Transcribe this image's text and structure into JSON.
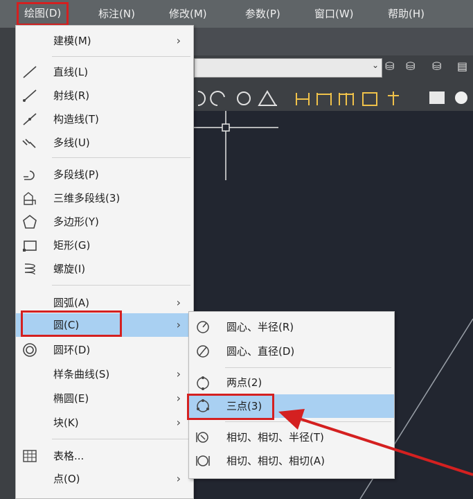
{
  "menubar": {
    "items": [
      "绘图(D)",
      "标注(N)",
      "修改(M)",
      "参数(P)",
      "窗口(W)",
      "帮助(H)"
    ]
  },
  "draw_menu": {
    "items": [
      {
        "label": "建模(M)",
        "icon": "",
        "submenu": true
      },
      {
        "label": "直线(L)",
        "icon": "line-icon"
      },
      {
        "label": "射线(R)",
        "icon": "ray-icon"
      },
      {
        "label": "构造线(T)",
        "icon": "construction-line-icon"
      },
      {
        "label": "多线(U)",
        "icon": "multiline-icon"
      },
      {
        "label": "多段线(P)",
        "icon": "polyline-icon"
      },
      {
        "label": "三维多段线(3)",
        "icon": "3d-polyline-icon"
      },
      {
        "label": "多边形(Y)",
        "icon": "polygon-icon"
      },
      {
        "label": "矩形(G)",
        "icon": "rectangle-icon"
      },
      {
        "label": "螺旋(I)",
        "icon": "helix-icon"
      },
      {
        "label": "圆弧(A)",
        "icon": "",
        "submenu": true
      },
      {
        "label": "圆(C)",
        "icon": "",
        "submenu": true,
        "active": true
      },
      {
        "label": "圆环(D)",
        "icon": "donut-icon"
      },
      {
        "label": "样条曲线(S)",
        "icon": "",
        "submenu": true
      },
      {
        "label": "椭圆(E)",
        "icon": "",
        "submenu": true
      },
      {
        "label": "块(K)",
        "icon": "",
        "submenu": true
      },
      {
        "label": "表格...",
        "icon": "table-icon"
      },
      {
        "label": "点(O)",
        "icon": "",
        "submenu": true
      }
    ]
  },
  "circle_submenu": {
    "items": [
      {
        "label": "圆心、半径(R)",
        "icon": "circle-center-radius-icon"
      },
      {
        "label": "圆心、直径(D)",
        "icon": "circle-center-diameter-icon"
      },
      {
        "label": "两点(2)",
        "icon": "circle-2point-icon"
      },
      {
        "label": "三点(3)",
        "icon": "circle-3point-icon",
        "active": true
      },
      {
        "label": "相切、相切、半径(T)",
        "icon": "circle-ttr-icon"
      },
      {
        "label": "相切、相切、相切(A)",
        "icon": "circle-ttt-icon"
      }
    ]
  },
  "colors": {
    "highlight": "#a9d0f2",
    "annotation_red": "#d42020",
    "canvas": "#222630"
  }
}
